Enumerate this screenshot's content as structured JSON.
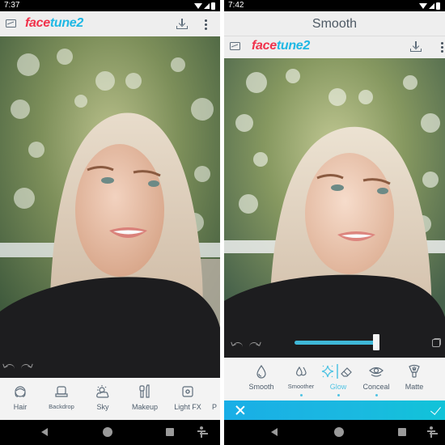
{
  "left_screen": {
    "status_bar": {
      "time": "7:37"
    },
    "toolbar": {
      "logo_part1": "face",
      "logo_part2": "tune2"
    },
    "tools": [
      {
        "label": "Hair",
        "icon": "hair-icon"
      },
      {
        "label": "Backdrop",
        "icon": "backdrop-icon"
      },
      {
        "label": "Sky",
        "icon": "sky-icon"
      },
      {
        "label": "Makeup",
        "icon": "makeup-icon"
      },
      {
        "label": "Light FX",
        "icon": "light-fx-icon"
      },
      {
        "label": "P",
        "icon": "partial-tool-icon"
      }
    ]
  },
  "right_screen": {
    "status_bar": {
      "time": "7:42"
    },
    "title": "Smooth",
    "toolbar": {
      "logo_part1": "face",
      "logo_part2": "tune2"
    },
    "slider": {
      "value_percent": 96
    },
    "tools": [
      {
        "label": "Smooth",
        "icon": "drop-icon",
        "active": false,
        "dot": false
      },
      {
        "label": "Smoother",
        "icon": "double-drop-icon",
        "active": false,
        "dot": true
      },
      {
        "label": "Glow",
        "icon": "sparkle-icon",
        "active": true,
        "dot": true
      },
      {
        "label": "Conceal",
        "icon": "eye-icon",
        "active": false,
        "dot": true
      },
      {
        "label": "Matte",
        "icon": "matte-brush-icon",
        "active": false,
        "dot": false
      }
    ]
  },
  "colors": {
    "brand_red": "#f0334c",
    "brand_blue": "#1fb8e4",
    "accent": "#4fc3e3",
    "toolbar_bg": "#eeeeee",
    "icon_gray": "#5f6e7c"
  }
}
